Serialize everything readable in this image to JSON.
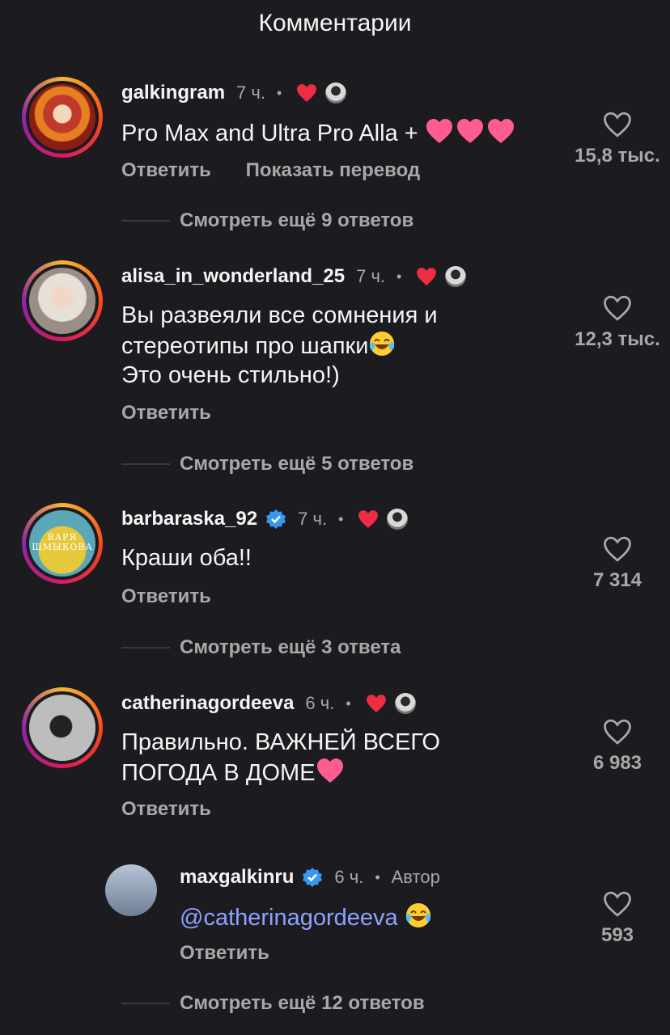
{
  "header": {
    "title": "Комментарии"
  },
  "comments": [
    {
      "username": "galkingram",
      "time": "7 ч.",
      "text": "Pro Max and Ultra Pro Alla +",
      "reply_label": "Ответить",
      "translate_label": "Показать перевод",
      "likes": "15,8 тыс.",
      "view_more": "Смотреть ещё 9 ответов"
    },
    {
      "username": "alisa_in_wonderland_25",
      "time": "7 ч.",
      "text_line1": "Вы развеяли все сомнения и",
      "text_line2": "стереотипы про шапки",
      "text_line3": "Это очень стильно!)",
      "reply_label": "Ответить",
      "likes": "12,3 тыс.",
      "view_more": "Смотреть ещё 5 ответов"
    },
    {
      "username": "barbaraska_92",
      "time": "7 ч.",
      "avatar_text_line1": "ВАРЯ",
      "avatar_text_line2": "ШМЫКОВА",
      "text": "Краши оба!!",
      "reply_label": "Ответить",
      "likes": "7 314",
      "view_more": "Смотреть ещё 3 ответа"
    },
    {
      "username": "catherinagordeeva",
      "time": "6 ч.",
      "text_line1": "Правильно. ВАЖНЕЙ ВСЕГО",
      "text_line2": "ПОГОДА В ДОМЕ",
      "reply_label": "Ответить",
      "likes": "6 983"
    }
  ],
  "reply": {
    "username": "maxgalkinru",
    "time": "6 ч.",
    "author_label": "Автор",
    "mention": "@catherinagordeeva",
    "reply_label": "Ответить",
    "likes": "593",
    "view_more": "Смотреть ещё 12 ответов"
  },
  "colors": {
    "background": "#1c1c20",
    "like_red": "#ef2d42",
    "verified_blue": "#3897f0",
    "mention": "#8ea1ff"
  }
}
